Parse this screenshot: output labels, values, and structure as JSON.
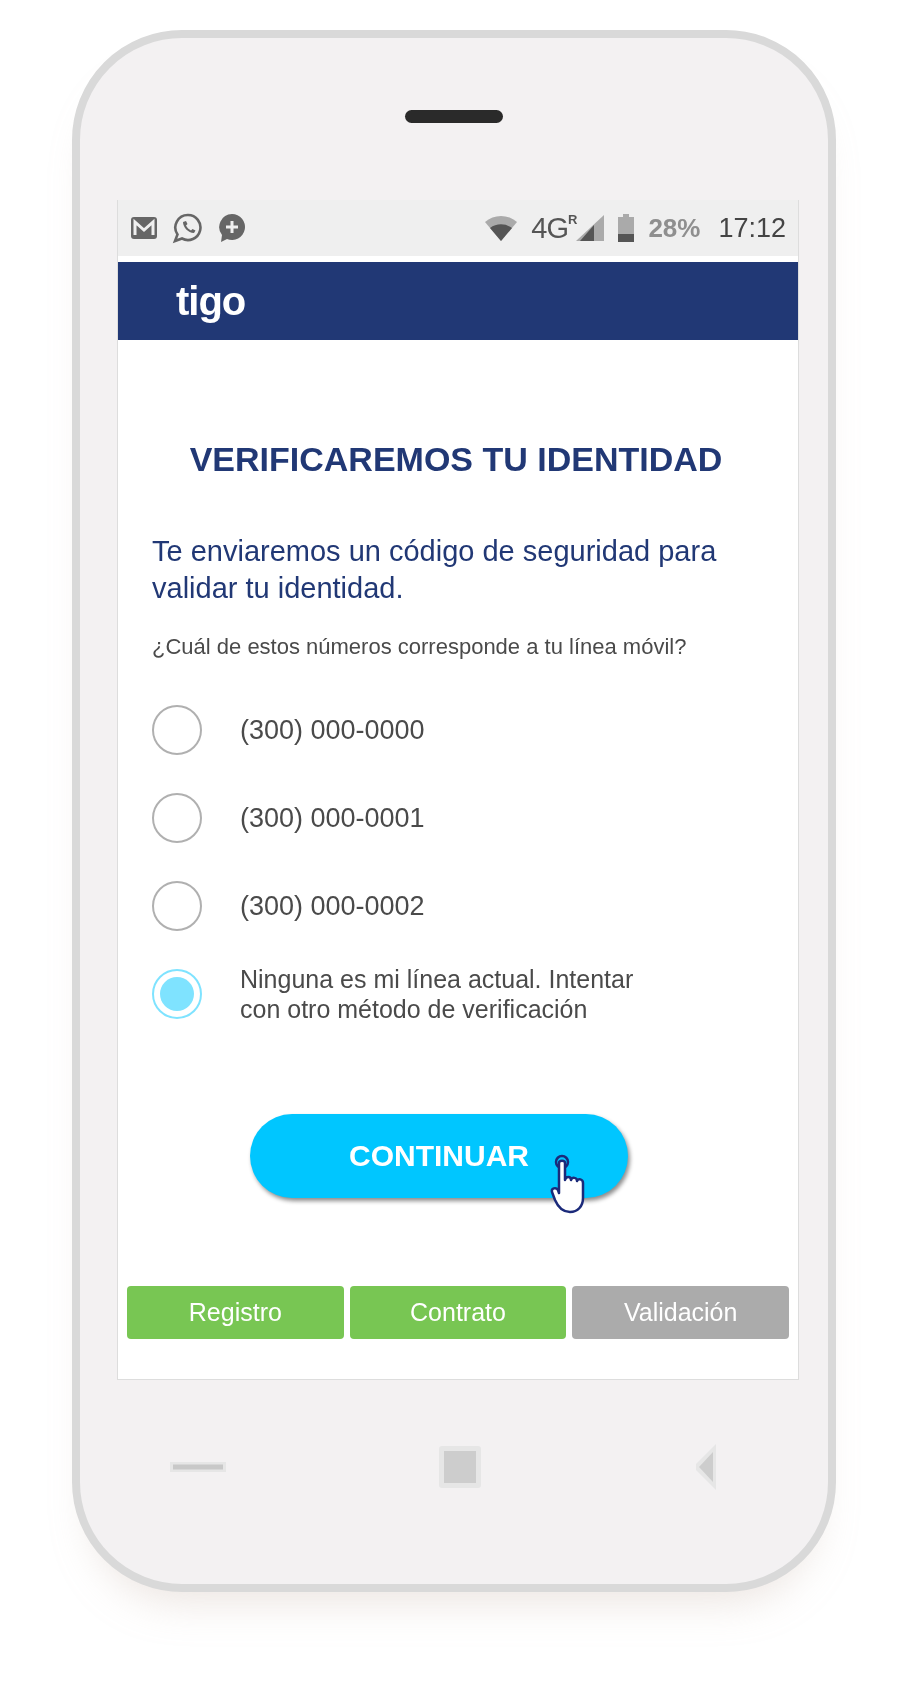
{
  "status_bar": {
    "network": "4G",
    "roaming": "R",
    "battery": "28%",
    "time": "17:12"
  },
  "header": {
    "logo": "tigo"
  },
  "title": "VERIFICAREMOS TU IDENTIDAD",
  "intro": "Te enviaremos un código de seguridad para validar tu identidad.",
  "question": "¿Cuál de estos números corresponde a tu línea móvil?",
  "options": [
    {
      "label": "(300) 000-0000",
      "selected": false
    },
    {
      "label": "(300) 000-0001",
      "selected": false
    },
    {
      "label": "(300) 000-0002",
      "selected": false
    },
    {
      "label": "Ninguna es mi línea actual. Intentar con otro método de verificación",
      "selected": true
    }
  ],
  "button": "CONTINUAR",
  "steps": [
    {
      "label": "Registro",
      "done": true
    },
    {
      "label": "Contrato",
      "done": true
    },
    {
      "label": "Validación",
      "done": false
    }
  ]
}
